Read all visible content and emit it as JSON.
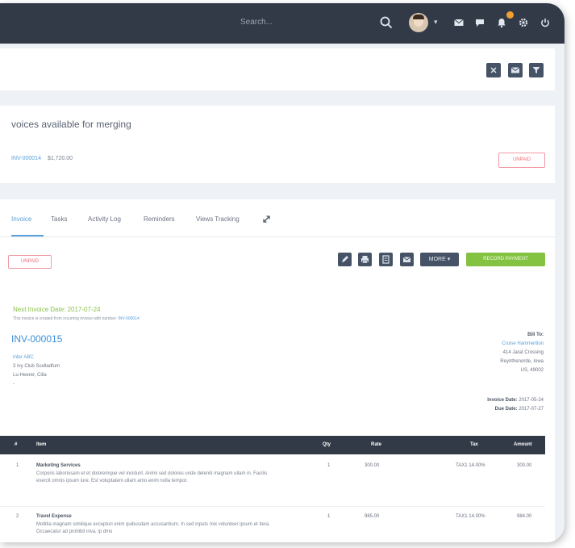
{
  "topbar": {
    "search_placeholder": "Search...",
    "icons": [
      "search-icon",
      "avatar",
      "envelope-icon",
      "chat-icon",
      "bell-icon",
      "gear-icon",
      "power-icon"
    ]
  },
  "toolbar": {
    "icons": [
      "close-icon",
      "mail-icon",
      "filter-icon"
    ]
  },
  "merge_notice": {
    "title": "voices available for merging",
    "invoice_link": "INV-000014",
    "amount": "$1,720.00",
    "status": "UNPAID"
  },
  "tabs": [
    {
      "label": "Invoice",
      "active": true
    },
    {
      "label": "Tasks",
      "active": false
    },
    {
      "label": "Activity Log",
      "active": false
    },
    {
      "label": "Reminders",
      "active": false
    },
    {
      "label": "Views Tracking",
      "active": false
    }
  ],
  "invoice": {
    "status": "UNPAID",
    "actions": [
      "edit-icon",
      "print-icon",
      "pdf-icon",
      "email-icon"
    ],
    "more_label": "MORE",
    "record_payment_label": "RECORD PAYMENT",
    "next_date": "Next Invoice Date: 2017-07-24",
    "recurring_note": "This invoice is created from recurring invoice with number:",
    "recurring_link": "INV-000014",
    "number": "INV-000015",
    "company": {
      "name": "Inter ABC",
      "line1": "3 Ivy Club Scelladfum",
      "line2": "Lu-Heerer, Cilia",
      "line3": "-"
    },
    "bill_to": {
      "label": "Bill To:",
      "client": "Cruise Hammertion",
      "line1": "414 Jarat Crossing",
      "line2": "Reynthenorde, Iowa",
      "line3": "US, 49002"
    },
    "invoice_date_label": "Invoice Date:",
    "invoice_date": "2017-05-24",
    "due_date_label": "Due Date:",
    "due_date": "2017-07-27"
  },
  "items_table": {
    "headers": [
      "#",
      "Item",
      "Qty",
      "Rate",
      "Tax",
      "Amount"
    ],
    "rows": [
      {
        "num": "1",
        "title": "Marketing Services",
        "desc": "Corporis laboriosam et et doloremque vel incidunt. Animi sed dolores unde deleniti magnam ullam in. Facilis exercit omnis ipsum iure. Est voluptatem ullam amo enim nulla tempor.",
        "qty": "1",
        "rate": "300.00",
        "tax": "TAX1 14.00%",
        "amount": "300.00"
      },
      {
        "num": "2",
        "title": "Travel Expense",
        "desc": "Mollitia magnam similique excepturi enim quibusdam accusantium. In sed inputs mix volunteer ipsum et itera. Occaecatur ad prohibit inva, ip dmo",
        "qty": "1",
        "rate": "985.00",
        "tax": "TAX1 14.00%",
        "amount": "984.00"
      }
    ]
  },
  "colors": {
    "topbar": "#323a48",
    "accent": "#5aa1dc",
    "success": "#84c341",
    "danger": "#ee6a78",
    "button": "#465366"
  }
}
